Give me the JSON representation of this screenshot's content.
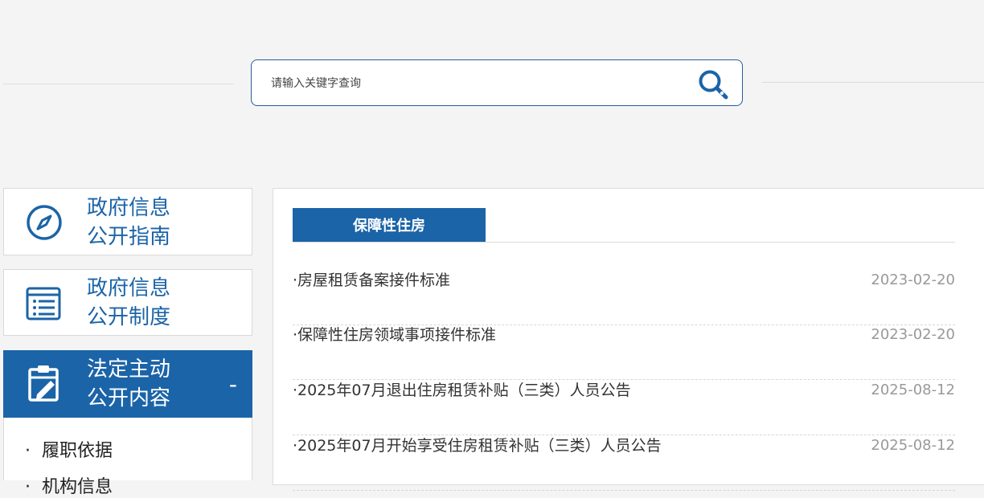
{
  "search": {
    "placeholder": "请输入关键字查询"
  },
  "menu": [
    {
      "line1": "政府信息",
      "line2": "公开指南",
      "active": false
    },
    {
      "line1": "政府信息",
      "line2": "公开制度",
      "active": false
    },
    {
      "line1": "法定主动",
      "line2": "公开内容",
      "active": true,
      "toggle": "-"
    }
  ],
  "submenu": [
    {
      "bullet": "·",
      "label": "履职依据"
    },
    {
      "bullet": "·",
      "label": "机构信息"
    }
  ],
  "content": {
    "tab": "保障性住房",
    "rows": [
      {
        "title": "·房屋租赁备案接件标准",
        "date": "2023-02-20"
      },
      {
        "title": "·保障性住房领域事项接件标准",
        "date": "2023-02-20"
      },
      {
        "title": "·2025年07月退出住房租赁补贴（三类）人员公告",
        "date": "2025-08-12"
      },
      {
        "title": "·2025年07月开始享受住房租赁补贴（三类）人员公告",
        "date": "2025-08-12"
      }
    ]
  },
  "colors": {
    "accent": "#1b64a8",
    "border": "#2a5b9c",
    "date": "#999999"
  }
}
